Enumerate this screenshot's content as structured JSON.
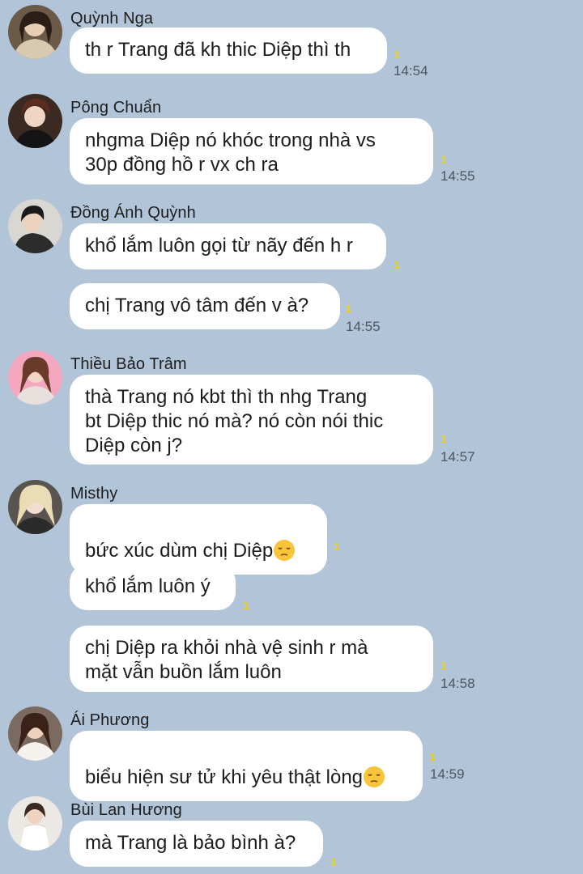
{
  "colors": {
    "background": "#b1c4d8",
    "bubble": "#ffffff",
    "unread_count": "#f2d300",
    "time": "#4d5560"
  },
  "messages_groups": [
    {
      "sender": "Quỳnh Nga",
      "avatar": "avatar-quynh-nga",
      "messages": [
        {
          "text": "th r Trang đã kh thic Diệp thì th",
          "count": "1",
          "time": "14:54"
        }
      ]
    },
    {
      "sender": "Pông Chuẩn",
      "avatar": "avatar-pong-chuan",
      "messages": [
        {
          "text": "nhgma Diệp nó khóc trong nhà vs\n30p đồng hồ r vx ch ra",
          "count": "1",
          "time": "14:55"
        }
      ]
    },
    {
      "sender": "Đồng Ánh Quỳnh",
      "avatar": "avatar-dong-anh-quynh",
      "messages": [
        {
          "text": "khổ lắm luôn gọi từ nãy đến h r",
          "count": "1",
          "time": ""
        },
        {
          "text": "chị Trang vô tâm đến v à?",
          "count": "1",
          "time": "14:55"
        }
      ]
    },
    {
      "sender": "Thiều Bảo Trâm",
      "avatar": "avatar-thieu-bao-tram",
      "messages": [
        {
          "text": "thà Trang nó kbt thì th nhg Trang\nbt Diệp thic nó mà? nó còn nói thic\nDiệp còn j?",
          "count": "1",
          "time": "14:57"
        }
      ]
    },
    {
      "sender": "Misthy",
      "avatar": "avatar-misthy",
      "messages": [
        {
          "text": "bức xúc dùm chị Diệp",
          "emoji": "pensive-face-emoji",
          "count": "1",
          "time": ""
        },
        {
          "text": "khổ lắm luôn ý",
          "count": "1",
          "time": ""
        },
        {
          "text": "chị Diệp ra khỏi nhà vệ sinh r mà\nmặt vẫn buồn lắm luôn",
          "count": "1",
          "time": "14:58"
        }
      ]
    },
    {
      "sender": "Ái Phương",
      "avatar": "avatar-ai-phuong",
      "messages": [
        {
          "text": "biểu hiện sư tử khi yêu thật lòng",
          "emoji": "pensive-face-emoji",
          "count": "1",
          "time": "14:59"
        }
      ]
    },
    {
      "sender": "Bùi Lan Hương",
      "avatar": "avatar-bui-lan-huong",
      "messages": [
        {
          "text": "mà Trang là bảo bình à?",
          "count": "1",
          "time": ""
        }
      ]
    }
  ]
}
